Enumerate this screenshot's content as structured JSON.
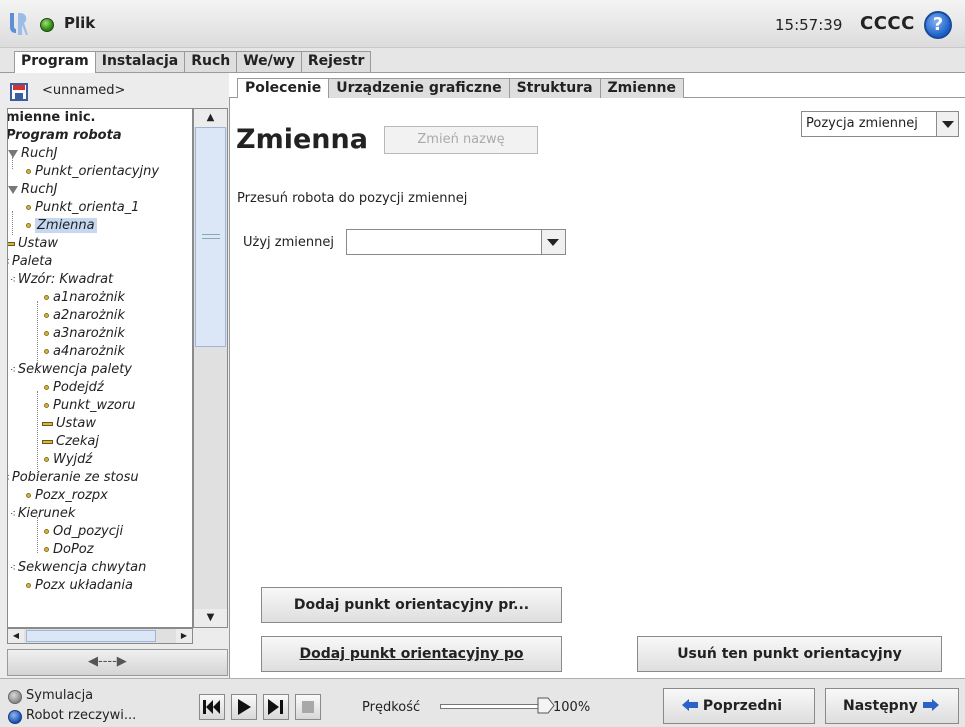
{
  "titlebar": {
    "file_menu": "Plik",
    "clock": "15:57:39",
    "robot_name": "CCCC",
    "help": "?"
  },
  "top_tabs": [
    "Program",
    "Instalacja",
    "Ruch",
    "We/wy",
    "Rejestr"
  ],
  "left": {
    "program_name": "<unnamed>",
    "tree": [
      "mienne inic.",
      "Program robota",
      "RuchJ",
      "Punkt_orientacyjny",
      "RuchJ",
      "Punkt_orienta_1",
      "Zmienna",
      "Ustaw",
      "Paleta",
      "Wzór: Kwadrat",
      "a1narożnik",
      "a2narożnik",
      "a3narożnik",
      "a4narożnik",
      "Sekwencja palety",
      "Podejdź",
      "Punkt_wzoru",
      "Ustaw",
      "Czekaj",
      "Wyjdź",
      "Pobieranie ze stosu",
      "Pozx_rozpx",
      "Kierunek",
      "Od_pozycji",
      "DoPoz",
      "Sekwencja chwytan",
      "Pozx układania"
    ],
    "collapse_glyph": "◀----▶"
  },
  "sub_tabs": [
    "Polecenie",
    "Urządzenie graficzne",
    "Struktura",
    "Zmienne"
  ],
  "content": {
    "heading": "Zmienna",
    "rename_button": "Zmień nazwę",
    "position_select": "Pozycja zmiennej",
    "move_text": "Przesuń robota do pozycji zmiennej",
    "use_label": "Użyj zmiennej",
    "use_value": "",
    "add_before_button": "Dodaj punkt orientacyjny pr...",
    "add_after_button": "Dodaj punkt orientacyjny po",
    "delete_button": "Usuń ten punkt orientacyjny"
  },
  "footer": {
    "simulation_label": "Symulacja",
    "real_robot_label": "Robot rzeczywi...",
    "speed_label": "Prędkość",
    "speed_value": "100%",
    "speed_fraction": 1.0,
    "prev_button": "Poprzedni",
    "next_button": "Następny"
  },
  "colors": {
    "status_green": "#2f8a14",
    "help_blue": "#1a5fc8",
    "selection": "#c6d8f0",
    "waypoint_gold": "#d8b640",
    "nav_arrow_blue": "#2a62c8"
  }
}
